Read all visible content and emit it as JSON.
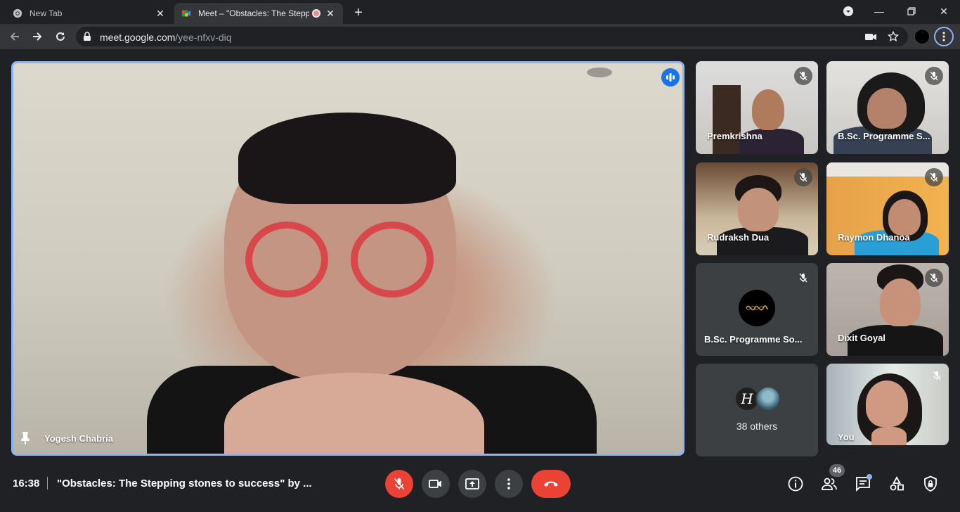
{
  "browser": {
    "tabs": [
      {
        "title": "New Tab",
        "favicon": "chrome-icon"
      },
      {
        "title": "Meet – \"Obstacles: The Stepping",
        "favicon": "meet-icon",
        "recording": true
      }
    ],
    "url_host": "meet.google.com",
    "url_path": "/yee-nfxv-diq"
  },
  "meet": {
    "main_speaker": {
      "name": "Yogesh Chabria",
      "speaking": true,
      "pinned": true
    },
    "tiles": [
      {
        "name": "Premkrishna",
        "muted": true
      },
      {
        "name": "B.Sc. Programme S...",
        "muted": true
      },
      {
        "name": "Rudraksh Dua",
        "muted": true
      },
      {
        "name": "Raymon Dhanoa",
        "muted": true
      },
      {
        "name": "B.Sc. Programme So...",
        "muted": true,
        "avatar": "logo-avatar"
      },
      {
        "name": "Dixit Goyal",
        "muted": true
      },
      {
        "others_label": "38 others",
        "avatar_letter": "H"
      },
      {
        "name": "You",
        "muted": true
      }
    ],
    "bottom_bar": {
      "time": "16:38",
      "meeting_title": "\"Obstacles: The Stepping stones to success\" by ...",
      "participant_count": "46"
    }
  },
  "colors": {
    "background": "#202124",
    "accent": "#8ab4f8",
    "speaking": "#1a73e8",
    "danger": "#ea4335",
    "tile": "#3c4043"
  }
}
